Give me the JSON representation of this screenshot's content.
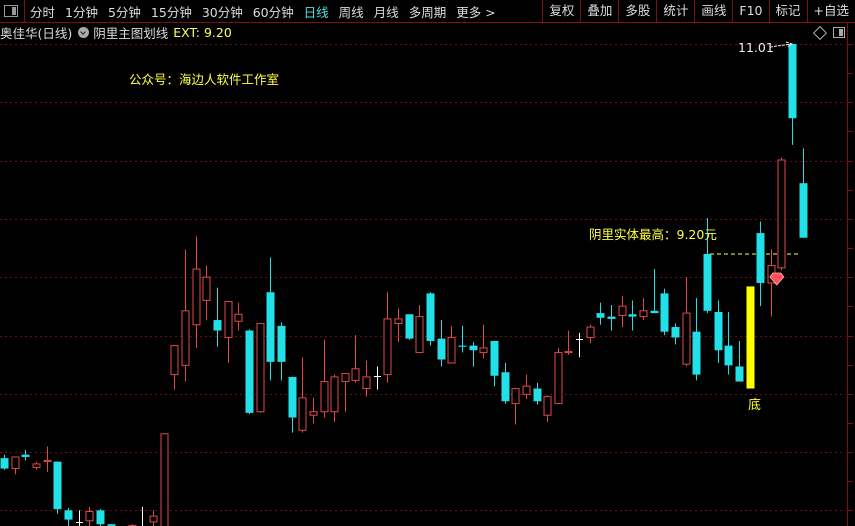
{
  "toolbar": {
    "periods": [
      "分时",
      "1分钟",
      "5分钟",
      "15分钟",
      "30分钟",
      "60分钟",
      "日线",
      "周线",
      "月线",
      "多周期",
      "更多 >"
    ],
    "active_period": "日线",
    "right_tools": [
      "复权",
      "叠加",
      "多股",
      "统计",
      "画线",
      "F10",
      "标记",
      "+自选"
    ]
  },
  "info": {
    "stock": "奥佳华(日线)",
    "indicator": "阴里主图划线",
    "ext": "EXT: 9.20"
  },
  "annotations": {
    "wechat": "公众号：海边人软件工作室",
    "max_label": "阴里实体最高：9.20元",
    "bottom_mark": "底",
    "high_label": "11.01"
  },
  "colors": {
    "up": "#e04848",
    "down": "#22e0e8",
    "highlight": "#ffff00",
    "grid": "#6a1010",
    "dash": "#ffff40",
    "background": "#000000"
  },
  "chart_data": {
    "type": "candlestick",
    "title": "奥佳华(日线)",
    "ylim": [
      6.6,
      11.05
    ],
    "max_body_line": 9.2,
    "fields": [
      "open",
      "high",
      "low",
      "close"
    ],
    "candles": [
      [
        7.44,
        7.47,
        7.34,
        7.35
      ],
      [
        7.35,
        7.45,
        7.3,
        7.45
      ],
      [
        7.47,
        7.51,
        7.42,
        7.45
      ],
      [
        7.36,
        7.41,
        7.34,
        7.39
      ],
      [
        7.41,
        7.54,
        7.32,
        7.42
      ],
      [
        7.41,
        7.41,
        6.96,
        7.0
      ],
      [
        6.99,
        7.01,
        6.82,
        6.91
      ],
      [
        6.89,
        6.99,
        6.84,
        6.89
      ],
      [
        6.9,
        7.02,
        6.84,
        6.98
      ],
      [
        6.99,
        7.0,
        6.82,
        6.87
      ],
      [
        6.87,
        6.87,
        6.8,
        6.82
      ],
      [
        6.8,
        6.83,
        6.72,
        6.75
      ],
      [
        6.78,
        6.87,
        6.75,
        6.86
      ],
      [
        6.8,
        7.02,
        6.75,
        6.8
      ],
      [
        6.89,
        6.99,
        6.84,
        6.94
      ],
      [
        6.7,
        7.65,
        6.68,
        7.65
      ],
      [
        8.16,
        8.41,
        8.03,
        8.41
      ],
      [
        8.24,
        9.24,
        8.1,
        8.71
      ],
      [
        8.59,
        9.35,
        8.39,
        9.07
      ],
      [
        8.8,
        9.1,
        8.63,
        9.0
      ],
      [
        8.63,
        8.91,
        8.4,
        8.54
      ],
      [
        8.48,
        8.79,
        8.26,
        8.79
      ],
      [
        8.62,
        8.78,
        8.54,
        8.68
      ],
      [
        8.54,
        8.55,
        7.82,
        7.83
      ],
      [
        7.84,
        8.6,
        7.83,
        8.6
      ],
      [
        8.87,
        9.17,
        8.11,
        8.27
      ],
      [
        8.58,
        8.61,
        8.11,
        8.27
      ],
      [
        8.14,
        8.14,
        7.66,
        7.79
      ],
      [
        7.68,
        8.31,
        7.66,
        7.96
      ],
      [
        7.81,
        7.96,
        7.74,
        7.84
      ],
      [
        7.84,
        8.46,
        7.79,
        8.1
      ],
      [
        7.84,
        8.16,
        7.75,
        8.14
      ],
      [
        8.1,
        8.17,
        7.84,
        8.17
      ],
      [
        8.11,
        8.5,
        8.09,
        8.21
      ],
      [
        8.04,
        8.28,
        7.97,
        8.14
      ],
      [
        8.15,
        8.23,
        8.03,
        8.15
      ],
      [
        8.16,
        8.87,
        8.09,
        8.64
      ],
      [
        8.6,
        8.73,
        8.44,
        8.64
      ],
      [
        8.68,
        8.68,
        8.46,
        8.47
      ],
      [
        8.35,
        8.76,
        8.35,
        8.66
      ],
      [
        8.86,
        8.87,
        8.41,
        8.45
      ],
      [
        8.47,
        8.63,
        8.23,
        8.29
      ],
      [
        8.26,
        8.58,
        8.26,
        8.48
      ],
      [
        8.41,
        8.58,
        8.35,
        8.4
      ],
      [
        8.41,
        8.44,
        8.23,
        8.37
      ],
      [
        8.35,
        8.59,
        8.3,
        8.39
      ],
      [
        8.45,
        8.45,
        8.06,
        8.15
      ],
      [
        8.18,
        8.26,
        7.91,
        7.93
      ],
      [
        7.91,
        8.04,
        7.73,
        8.04
      ],
      [
        7.99,
        8.16,
        7.95,
        8.06
      ],
      [
        8.04,
        8.09,
        7.9,
        7.93
      ],
      [
        7.81,
        7.98,
        7.75,
        7.97
      ],
      [
        7.91,
        8.39,
        7.91,
        8.35
      ],
      [
        8.35,
        8.54,
        8.33,
        8.36
      ],
      [
        8.47,
        8.52,
        8.31,
        8.47
      ],
      [
        8.48,
        8.59,
        8.43,
        8.57
      ],
      [
        8.69,
        8.78,
        8.59,
        8.65
      ],
      [
        8.66,
        8.76,
        8.54,
        8.64
      ],
      [
        8.67,
        8.84,
        8.57,
        8.75
      ],
      [
        8.68,
        8.8,
        8.54,
        8.66
      ],
      [
        8.66,
        8.82,
        8.63,
        8.71
      ],
      [
        8.71,
        9.07,
        8.69,
        8.69
      ],
      [
        8.86,
        8.9,
        8.5,
        8.53
      ],
      [
        8.57,
        8.6,
        8.42,
        8.48
      ],
      [
        8.25,
        9.0,
        8.23,
        8.69
      ],
      [
        8.53,
        8.82,
        8.11,
        8.16
      ],
      [
        9.2,
        9.51,
        8.69,
        8.71
      ],
      [
        8.7,
        8.8,
        8.26,
        8.37
      ],
      [
        8.41,
        8.7,
        8.16,
        8.24
      ],
      [
        8.23,
        8.45,
        8.1,
        8.1
      ],
      [
        8.92,
        8.92,
        8.04,
        8.04
      ],
      [
        9.38,
        9.48,
        8.75,
        8.95
      ],
      [
        8.95,
        9.24,
        8.66,
        9.1
      ],
      [
        9.08,
        10.03,
        9.06,
        10.01
      ],
      [
        11.01,
        11.01,
        10.14,
        10.37
      ],
      [
        9.81,
        10.11,
        9.34,
        9.34
      ]
    ],
    "highlight_index": 70,
    "gem_index": 72
  }
}
